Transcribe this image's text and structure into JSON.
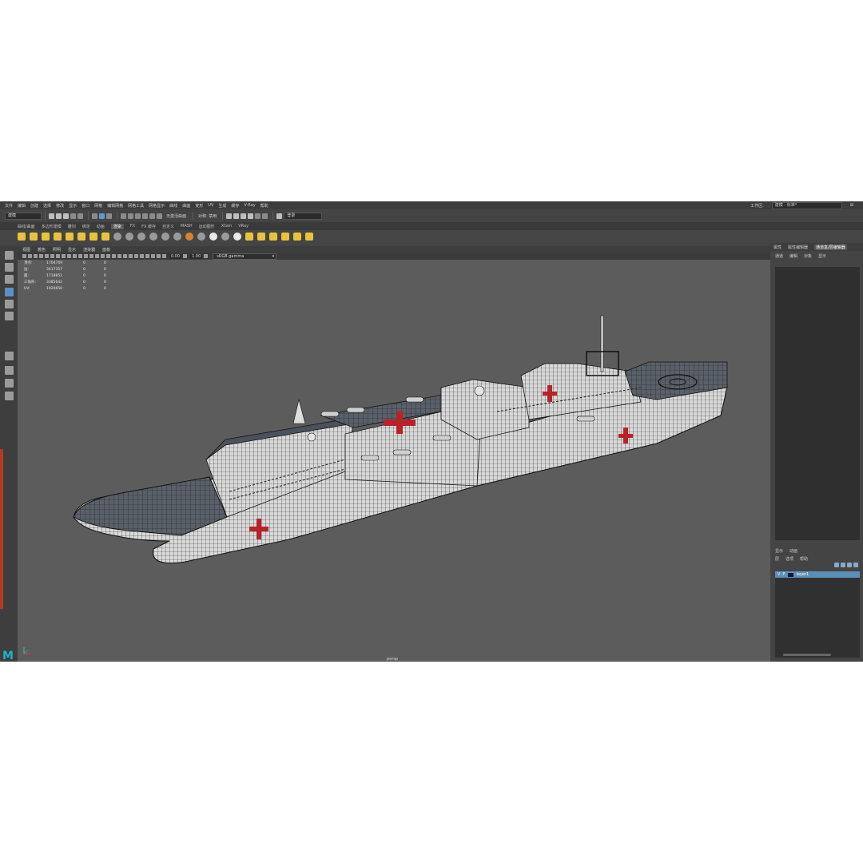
{
  "menubar": {
    "items": [
      "文件",
      "编辑",
      "创建",
      "选择",
      "修改",
      "显示",
      "窗口",
      "网格",
      "编辑网格",
      "网格工具",
      "网格显示",
      "曲线",
      "曲面",
      "变形",
      "UV",
      "生成",
      "缓存",
      "V-Ray",
      "帮助"
    ],
    "workspace_label": "工作区:",
    "workspace_value": "建模 - 标准*"
  },
  "statusline": {
    "mode": "建模",
    "live_surface": "无激活曲面",
    "symmetry": "对称: 禁用",
    "login": "登录"
  },
  "shelf": {
    "tabs": [
      "曲线/曲面",
      "多边形建模",
      "雕刻",
      "绑定",
      "动画",
      "渲染",
      "FX",
      "FX 缓存",
      "自定义",
      "MASH",
      "运动图形",
      "XGen",
      "VRay"
    ],
    "active_tab": "渲染"
  },
  "panel_menu": [
    "视图",
    "着色",
    "照明",
    "显示",
    "渲染器",
    "面板"
  ],
  "viewport_toolbar": {
    "exposure": "0.00",
    "gamma": "1.00",
    "color_space": "sRGB gamma"
  },
  "hud": [
    {
      "label": "顶点:",
      "value": "1704749",
      "c1": "0",
      "c2": "0"
    },
    {
      "label": "边:",
      "value": "3417357",
      "c1": "0",
      "c2": "0"
    },
    {
      "label": "面:",
      "value": "1718851",
      "c1": "0",
      "c2": "0"
    },
    {
      "label": "三角形:",
      "value": "3385642",
      "c1": "0",
      "c2": "0"
    },
    {
      "label": "UV:",
      "value": "1920650",
      "c1": "0",
      "c2": "0"
    }
  ],
  "camera": "persp",
  "right_panel": {
    "tabs": [
      "属性",
      "属性编辑器",
      "通道盒/层编辑器"
    ],
    "active_tab": "通道盒/层编辑器",
    "channel_menu": [
      "通道",
      "编辑",
      "对象",
      "显示"
    ],
    "layer_tabs": [
      "显示",
      "动画"
    ],
    "layer_menu": [
      "层",
      "选项",
      "帮助"
    ],
    "layer": {
      "v": "V",
      "p": "P",
      "name": "layer1"
    }
  },
  "colors": {
    "accent": "#5b8fb9",
    "viewport": "#5c5c5c",
    "cross": "#b8232a",
    "maya_logo": "#1fb5c4"
  }
}
